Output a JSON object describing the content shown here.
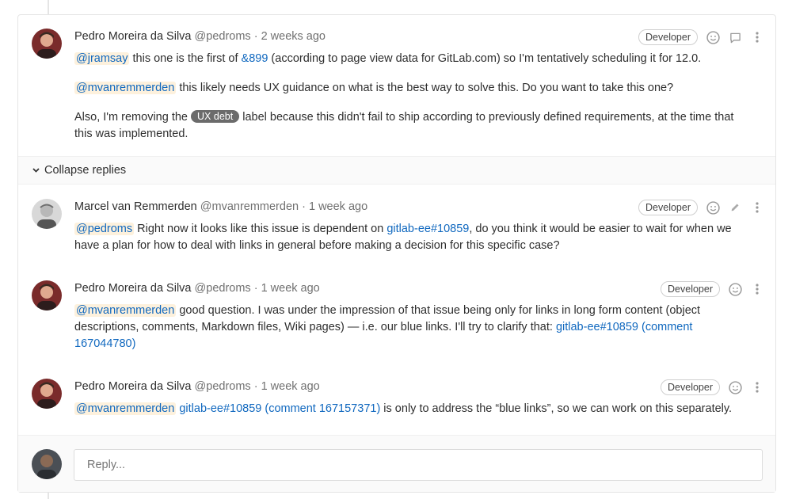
{
  "colors": {
    "link": "#1068bf",
    "mention_bg": "#fdf1dd",
    "label_bg": "#6b6b6b",
    "muted": "#707070"
  },
  "notes": [
    {
      "author": "Pedro Moreira da Silva",
      "handle": "@pedroms",
      "sep": "·",
      "time": "2 weeks ago",
      "role": "Developer",
      "p1": {
        "mention": "@jramsay",
        "t1": " this one is the first of ",
        "link": "&899",
        "t2": " (according to page view data for GitLab.com) so I'm tentatively scheduling it for 12.0."
      },
      "p2": {
        "mention": "@mvanremmerden",
        "t1": " this likely needs UX guidance on what is the best way to solve this. Do you want to take this one?"
      },
      "p3": {
        "t1": "Also, I'm removing the ",
        "label": "UX debt",
        "t2": " label because this didn't fail to ship according to previously defined requirements, at the time that this was implemented."
      }
    },
    {
      "author": "Marcel van Remmerden",
      "handle": "@mvanremmerden",
      "sep": "·",
      "time": "1 week ago",
      "role": "Developer",
      "p1": {
        "mention": "@pedroms",
        "t1": " Right now it looks like this issue is dependent on ",
        "link": "gitlab-ee#10859",
        "t2": ", do you think it would be easier to wait for when we have a plan for how to deal with links in general before making a decision for this specific case?"
      }
    },
    {
      "author": "Pedro Moreira da Silva",
      "handle": "@pedroms",
      "sep": "·",
      "time": "1 week ago",
      "role": "Developer",
      "p1": {
        "mention": "@mvanremmerden",
        "t1": " good question. I was under the impression of that issue being only for links in long form content (object descriptions, comments, Markdown files, Wiki pages) — i.e. our blue links. I'll try to clarify that: ",
        "link": "gitlab-ee#10859 (comment 167044780)"
      }
    },
    {
      "author": "Pedro Moreira da Silva",
      "handle": "@pedroms",
      "sep": "·",
      "time": "1 week ago",
      "role": "Developer",
      "p1": {
        "mention": "@mvanremmerden",
        "t1": " ",
        "link": "gitlab-ee#10859 (comment 167157371)",
        "t2": " is only to address the “blue links”, so we can work on this separately."
      }
    }
  ],
  "collapse": {
    "label": "Collapse replies",
    "icon": "chevron-down-icon"
  },
  "reply": {
    "placeholder": "Reply..."
  },
  "icons": [
    "smiley-icon",
    "comment-icon",
    "pencil-icon",
    "kebab-menu-icon"
  ]
}
